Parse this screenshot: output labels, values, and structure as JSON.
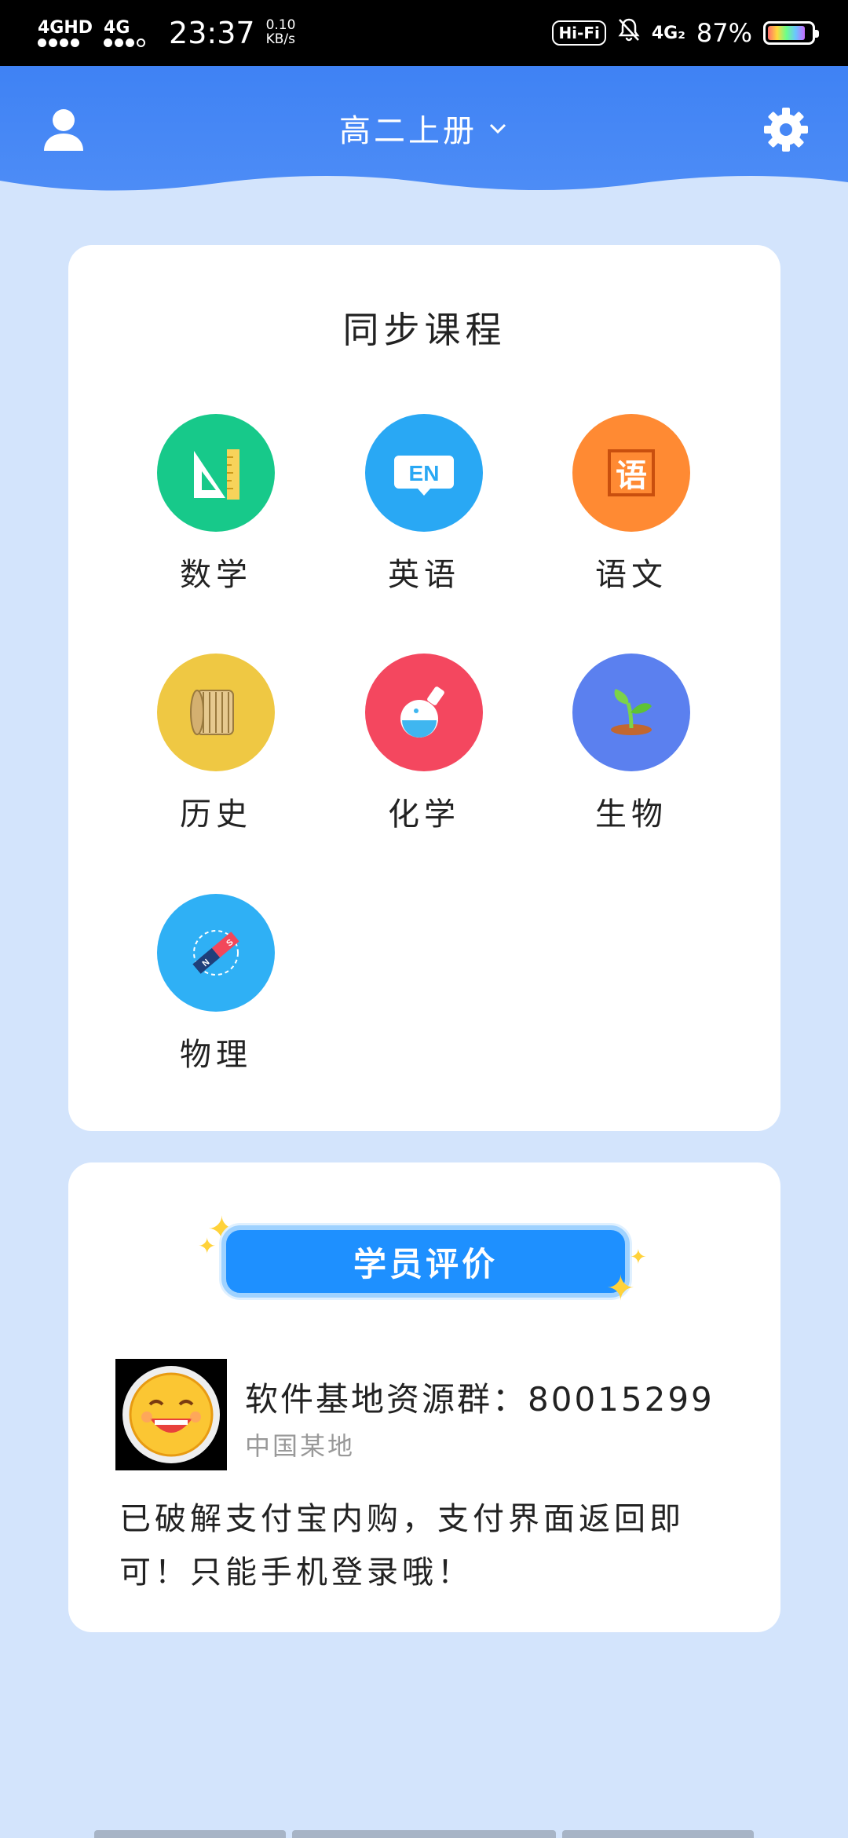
{
  "status_bar": {
    "sim1": "4GHD",
    "sim2": "4G",
    "time": "23:37",
    "speed_value": "0.10",
    "speed_unit": "KB/s",
    "hifi": "Hi-Fi",
    "network": "4G₂",
    "battery": "87%",
    "battery_level": 0.87
  },
  "header": {
    "term": "高二上册"
  },
  "courses": {
    "title": "同步课程",
    "subjects": [
      {
        "label": "数学",
        "icon": "ruler-triangle-icon",
        "color": "#17c98a"
      },
      {
        "label": "英语",
        "icon": "en-bubble-icon",
        "color": "#29a8f4"
      },
      {
        "label": "语文",
        "icon": "chinese-char-icon",
        "color": "#ff8a33"
      },
      {
        "label": "历史",
        "icon": "bamboo-scroll-icon",
        "color": "#efc843"
      },
      {
        "label": "化学",
        "icon": "flask-icon",
        "color": "#f4475f"
      },
      {
        "label": "生物",
        "icon": "sprout-icon",
        "color": "#5b80ef"
      },
      {
        "label": "物理",
        "icon": "magnet-compass-icon",
        "color": "#2fb0f5"
      }
    ]
  },
  "reviews": {
    "badge": "学员评价",
    "reviewer": "软件基地资源群：80015299",
    "location": "中国某地",
    "text": "已破解支付宝内购，支付界面返回即可！只能手机登录哦！"
  }
}
